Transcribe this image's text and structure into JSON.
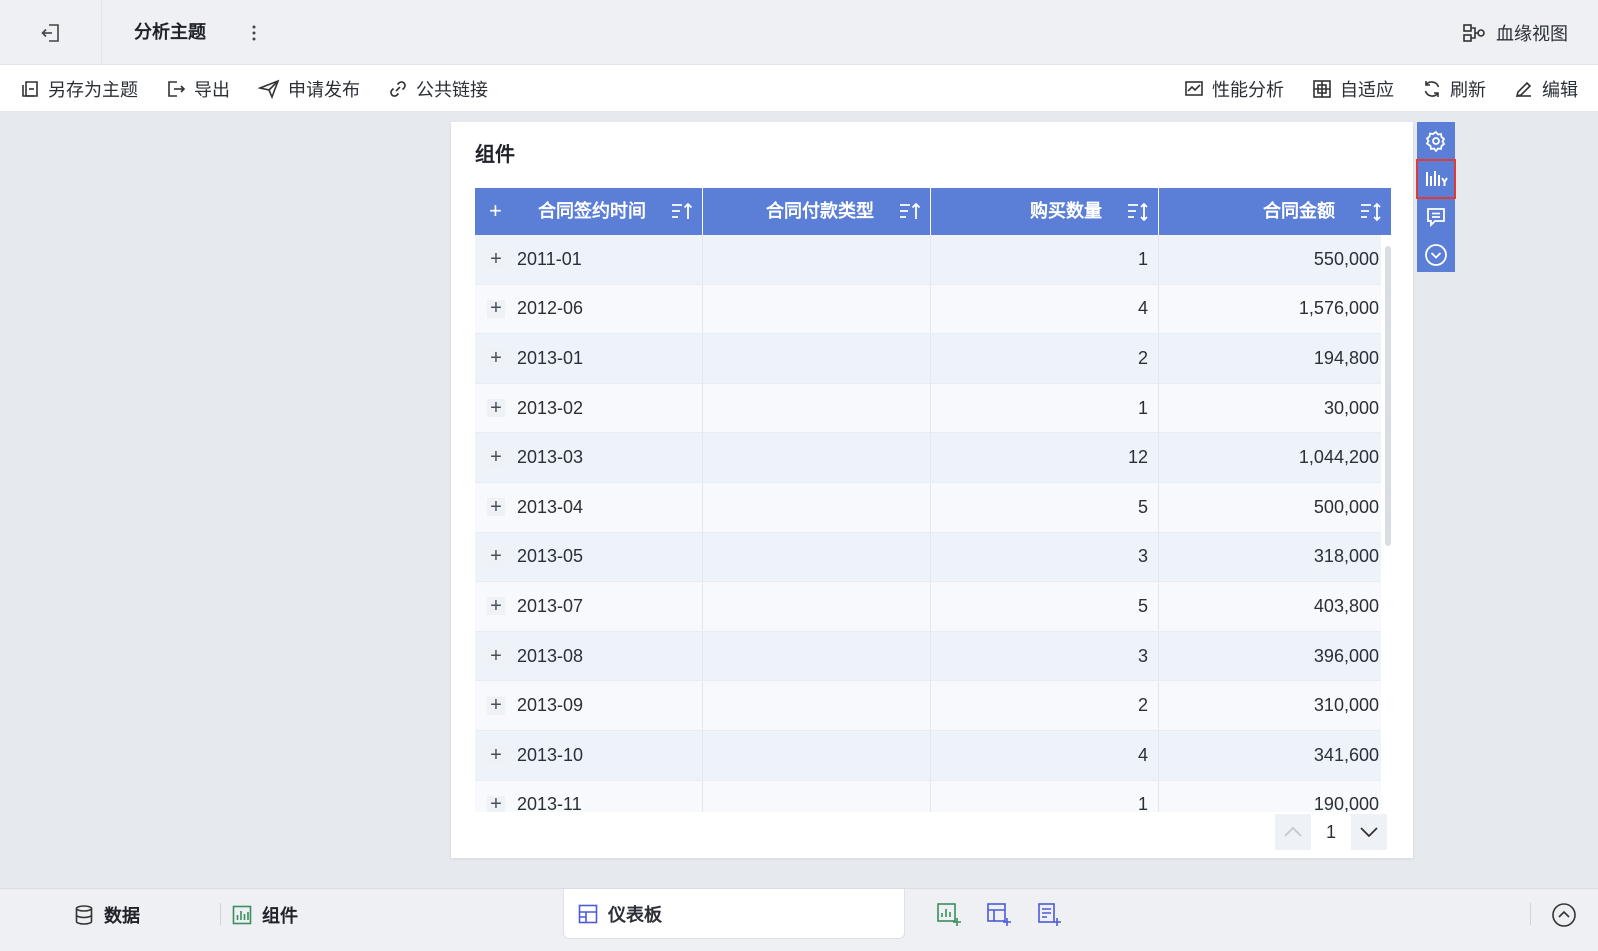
{
  "header": {
    "subject_title": "分析主题",
    "lineage_label": "血缘视图"
  },
  "toolbar": {
    "save_as_label": "另存为主题",
    "export_label": "导出",
    "publish_label": "申请发布",
    "public_link_label": "公共链接",
    "perf_label": "性能分析",
    "adaptive_label": "自适应",
    "refresh_label": "刷新",
    "edit_label": "编辑"
  },
  "card": {
    "title": "组件",
    "columns": [
      "合同签约时间",
      "合同付款类型",
      "购买数量",
      "合同金额"
    ],
    "rows": [
      {
        "date": "2011-01",
        "type": "",
        "qty": "1",
        "amount": "550,000"
      },
      {
        "date": "2012-06",
        "type": "",
        "qty": "4",
        "amount": "1,576,000"
      },
      {
        "date": "2013-01",
        "type": "",
        "qty": "2",
        "amount": "194,800"
      },
      {
        "date": "2013-02",
        "type": "",
        "qty": "1",
        "amount": "30,000"
      },
      {
        "date": "2013-03",
        "type": "",
        "qty": "12",
        "amount": "1,044,200"
      },
      {
        "date": "2013-04",
        "type": "",
        "qty": "5",
        "amount": "500,000"
      },
      {
        "date": "2013-05",
        "type": "",
        "qty": "3",
        "amount": "318,000"
      },
      {
        "date": "2013-07",
        "type": "",
        "qty": "5",
        "amount": "403,800"
      },
      {
        "date": "2013-08",
        "type": "",
        "qty": "3",
        "amount": "396,000"
      },
      {
        "date": "2013-09",
        "type": "",
        "qty": "2",
        "amount": "310,000"
      },
      {
        "date": "2013-10",
        "type": "",
        "qty": "4",
        "amount": "341,600"
      },
      {
        "date": "2013-11",
        "type": "",
        "qty": "1",
        "amount": "190,000"
      }
    ],
    "page_number": "1"
  },
  "bottom": {
    "data_tab": "数据",
    "component_tab": "组件",
    "dashboard_tab": "仪表板"
  },
  "colors": {
    "header_blue": "#5b7ed6",
    "highlight_red": "#e03b3b"
  }
}
